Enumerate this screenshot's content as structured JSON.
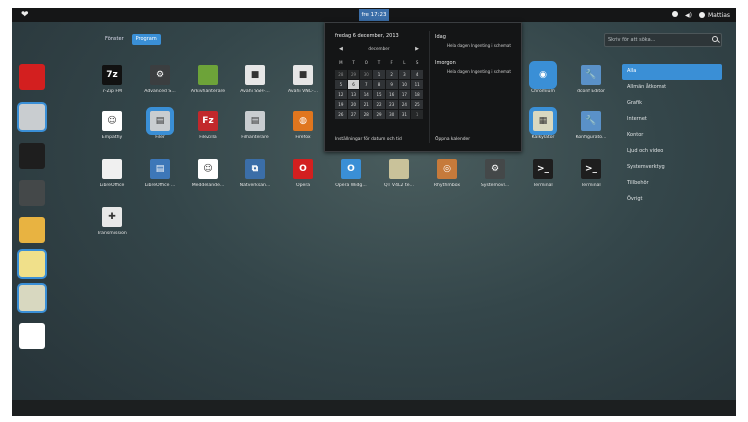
{
  "topbar": {
    "clock": "fre 17:23",
    "user": "Mattias"
  },
  "filters": [
    {
      "label": "Fönster",
      "selected": false
    },
    {
      "label": "Program",
      "selected": true
    }
  ],
  "search": {
    "placeholder": "Skriv för att söka..."
  },
  "categories": [
    {
      "label": "Alla",
      "selected": true
    },
    {
      "label": "Allmän åtkomst",
      "selected": false
    },
    {
      "label": "Grafik",
      "selected": false
    },
    {
      "label": "Internet",
      "selected": false
    },
    {
      "label": "Kontor",
      "selected": false
    },
    {
      "label": "Ljud och video",
      "selected": false
    },
    {
      "label": "Systemverktyg",
      "selected": false
    },
    {
      "label": "Tillbehör",
      "selected": false
    },
    {
      "label": "Övrigt",
      "selected": false
    }
  ],
  "dock": [
    {
      "name": "opera",
      "color": "#d31f1f",
      "active": false
    },
    {
      "name": "files",
      "color": "#c9cdd0",
      "active": true
    },
    {
      "name": "terminal",
      "color": "#1e1e1e",
      "active": false
    },
    {
      "name": "system-monitor",
      "color": "#444849",
      "active": false
    },
    {
      "name": "image-viewer",
      "color": "#e8b341",
      "active": false
    },
    {
      "name": "text-editor",
      "color": "#f0e08a",
      "active": true
    },
    {
      "name": "calculator",
      "color": "#d8d8c0",
      "active": true
    },
    {
      "name": "empathy",
      "color": "#ffffff",
      "active": false
    }
  ],
  "apps": [
    {
      "label": "7-Zip FM",
      "icon": "7z-icon",
      "color": "#111111",
      "glyph": "7z",
      "active": false
    },
    {
      "label": "Advanced S...",
      "icon": "advanced-settings-icon",
      "color": "#3b3e40",
      "glyph": "⚙",
      "active": false
    },
    {
      "label": "Arkivhanterare",
      "icon": "archive-icon",
      "color": "#6da339",
      "glyph": "",
      "active": false
    },
    {
      "label": "Avahi SSH-...",
      "icon": "avahi-ssh-icon",
      "color": "#e6e6e6",
      "glyph": "■",
      "active": false
    },
    {
      "label": "Avahi VNC-...",
      "icon": "avahi-vnc-icon",
      "color": "#e6e6e6",
      "glyph": "■",
      "active": false
    },
    {
      "label": "Chromium",
      "icon": "chromium-icon",
      "color": "#3a8fd6",
      "glyph": "◉",
      "active": true
    },
    {
      "label": "dconf Editor",
      "icon": "dconf-icon",
      "color": "#5a91c8",
      "glyph": "🔧",
      "active": false
    },
    {
      "label": "Empathy",
      "icon": "empathy-icon",
      "color": "#ffffff",
      "glyph": "☺",
      "active": false
    },
    {
      "label": "Filer",
      "icon": "files-icon",
      "color": "#c9cdd0",
      "glyph": "▤",
      "active": true
    },
    {
      "label": "FileZilla",
      "icon": "filezilla-icon",
      "color": "#c2282c",
      "glyph": "Fz",
      "active": false
    },
    {
      "label": "Filhanterare",
      "icon": "file-manager-icon",
      "color": "#c9cdd0",
      "glyph": "▤",
      "active": false
    },
    {
      "label": "Firefox",
      "icon": "firefox-icon",
      "color": "#e0761e",
      "glyph": "◍",
      "active": false
    },
    {
      "label": "Kalkylator",
      "icon": "calculator-icon",
      "color": "#d8d8c0",
      "glyph": "▦",
      "active": true
    },
    {
      "label": "Konfigurato...",
      "icon": "configurator-icon",
      "color": "#5a91c8",
      "glyph": "🔧",
      "active": false
    },
    {
      "label": "LibreOffice",
      "icon": "libreoffice-icon",
      "color": "#f0f0f0",
      "glyph": "",
      "active": false
    },
    {
      "label": "LibreOffice ...",
      "icon": "libreoffice-writer-icon",
      "color": "#3d77b8",
      "glyph": "▤",
      "active": false
    },
    {
      "label": "Meddelande...",
      "icon": "messaging-icon",
      "color": "#ffffff",
      "glyph": "☺",
      "active": false
    },
    {
      "label": "Nätverksan...",
      "icon": "network-icon",
      "color": "#3b6ea8",
      "glyph": "⧉",
      "active": false
    },
    {
      "label": "Opera",
      "icon": "opera-icon",
      "color": "#d31f1f",
      "glyph": "O",
      "active": false
    },
    {
      "label": "Opera Widg...",
      "icon": "opera-widgets-icon",
      "color": "#3a8fd6",
      "glyph": "O",
      "active": false
    },
    {
      "label": "QT V4L2 te...",
      "icon": "qt-v4l2-icon",
      "color": "#c9c29a",
      "glyph": "",
      "active": false
    },
    {
      "label": "Rhythmbox",
      "icon": "rhythmbox-icon",
      "color": "#c67a3b",
      "glyph": "◎",
      "active": false
    },
    {
      "label": "Systemövl...",
      "icon": "system-monitor-icon",
      "color": "#444849",
      "glyph": "⚙",
      "active": false
    },
    {
      "label": "Terminal",
      "icon": "terminal-icon",
      "color": "#1e1e1e",
      "glyph": ">_",
      "active": false
    },
    {
      "label": "Terminal",
      "icon": "terminal-icon",
      "color": "#1e1e1e",
      "glyph": ">_",
      "active": false
    },
    {
      "label": "Transmission",
      "icon": "transmission-icon",
      "color": "#e8e8e8",
      "glyph": "✚",
      "active": false
    }
  ],
  "calendar": {
    "date_label": "fredag 6 december, 2013",
    "month_label": "december",
    "weekdays": [
      "M",
      "T",
      "O",
      "T",
      "F",
      "L",
      "S"
    ],
    "days": [
      {
        "d": "28",
        "other": true
      },
      {
        "d": "29",
        "other": true
      },
      {
        "d": "30",
        "other": true
      },
      {
        "d": "1"
      },
      {
        "d": "2"
      },
      {
        "d": "3"
      },
      {
        "d": "4"
      },
      {
        "d": "5"
      },
      {
        "d": "6",
        "today": true
      },
      {
        "d": "7"
      },
      {
        "d": "8"
      },
      {
        "d": "9"
      },
      {
        "d": "10"
      },
      {
        "d": "11"
      },
      {
        "d": "12"
      },
      {
        "d": "13"
      },
      {
        "d": "14"
      },
      {
        "d": "15"
      },
      {
        "d": "16"
      },
      {
        "d": "17"
      },
      {
        "d": "18"
      },
      {
        "d": "19"
      },
      {
        "d": "20"
      },
      {
        "d": "21"
      },
      {
        "d": "22"
      },
      {
        "d": "23"
      },
      {
        "d": "24"
      },
      {
        "d": "25"
      },
      {
        "d": "26"
      },
      {
        "d": "27"
      },
      {
        "d": "28"
      },
      {
        "d": "29"
      },
      {
        "d": "30"
      },
      {
        "d": "31"
      },
      {
        "d": "1",
        "other": true
      }
    ],
    "today_title": "Idag",
    "today_event": "Hela dagen   Ingenting i schemat",
    "tomorrow_title": "Imorgon",
    "tomorrow_event": "Hela dagen   Ingenting i schemat",
    "settings_label": "Inställningar för datum och tid",
    "open_calendar_label": "Öppna kalender"
  }
}
